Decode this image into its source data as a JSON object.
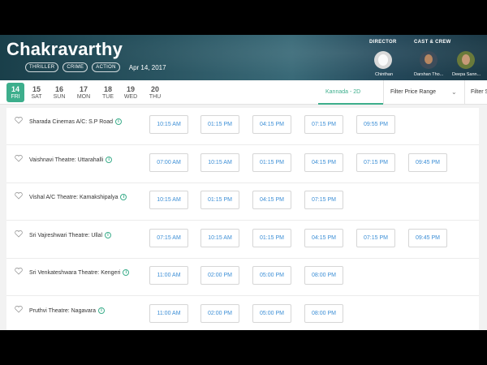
{
  "movie": {
    "title": "Chakravarthy",
    "tags": [
      "THRILLER",
      "CRIME",
      "ACTION"
    ],
    "release_date": "Apr 14, 2017"
  },
  "crew": {
    "director_heading": "DIRECTOR",
    "cast_heading": "CAST & CREW",
    "people": [
      "Chinthan",
      "Darshan Tho...",
      "Deepa Sann..."
    ]
  },
  "dates": [
    {
      "num": "14",
      "day": "FRI",
      "active": true
    },
    {
      "num": "15",
      "day": "SAT"
    },
    {
      "num": "16",
      "day": "SUN"
    },
    {
      "num": "17",
      "day": "MON"
    },
    {
      "num": "18",
      "day": "TUE"
    },
    {
      "num": "19",
      "day": "WED"
    },
    {
      "num": "20",
      "day": "THU"
    }
  ],
  "filters": {
    "language": "Kannada - 2D",
    "price": "Filter Price Range",
    "more": "Filter S"
  },
  "theatres": [
    {
      "name": "Sharada Cinemas A/C: S.P Road",
      "times": [
        "10:15 AM",
        "01:15 PM",
        "04:15 PM",
        "07:15 PM",
        "09:55 PM"
      ]
    },
    {
      "name": "Vaishnavi Theatre: Uttarahalli",
      "times": [
        "07:00 AM",
        "10:15 AM",
        "01:15 PM",
        "04:15 PM",
        "07:15 PM",
        "09:45 PM"
      ]
    },
    {
      "name": "Vishal A/C Theatre: Kamakshipalya",
      "times": [
        "10:15 AM",
        "01:15 PM",
        "04:15 PM",
        "07:15 PM"
      ]
    },
    {
      "name": "Sri Vajreshwari Theatre: Ullal",
      "times": [
        "07:15 AM",
        "10:15 AM",
        "01:15 PM",
        "04:15 PM",
        "07:15 PM",
        "09:45 PM"
      ]
    },
    {
      "name": "Sri Venkateshwara Theatre: Kengeri",
      "times": [
        "11:00 AM",
        "02:00 PM",
        "05:00 PM",
        "08:00 PM"
      ]
    },
    {
      "name": "Pruthvi Theatre: Nagavara",
      "times": [
        "11:00 AM",
        "02:00 PM",
        "05:00 PM",
        "08:00 PM"
      ]
    }
  ]
}
